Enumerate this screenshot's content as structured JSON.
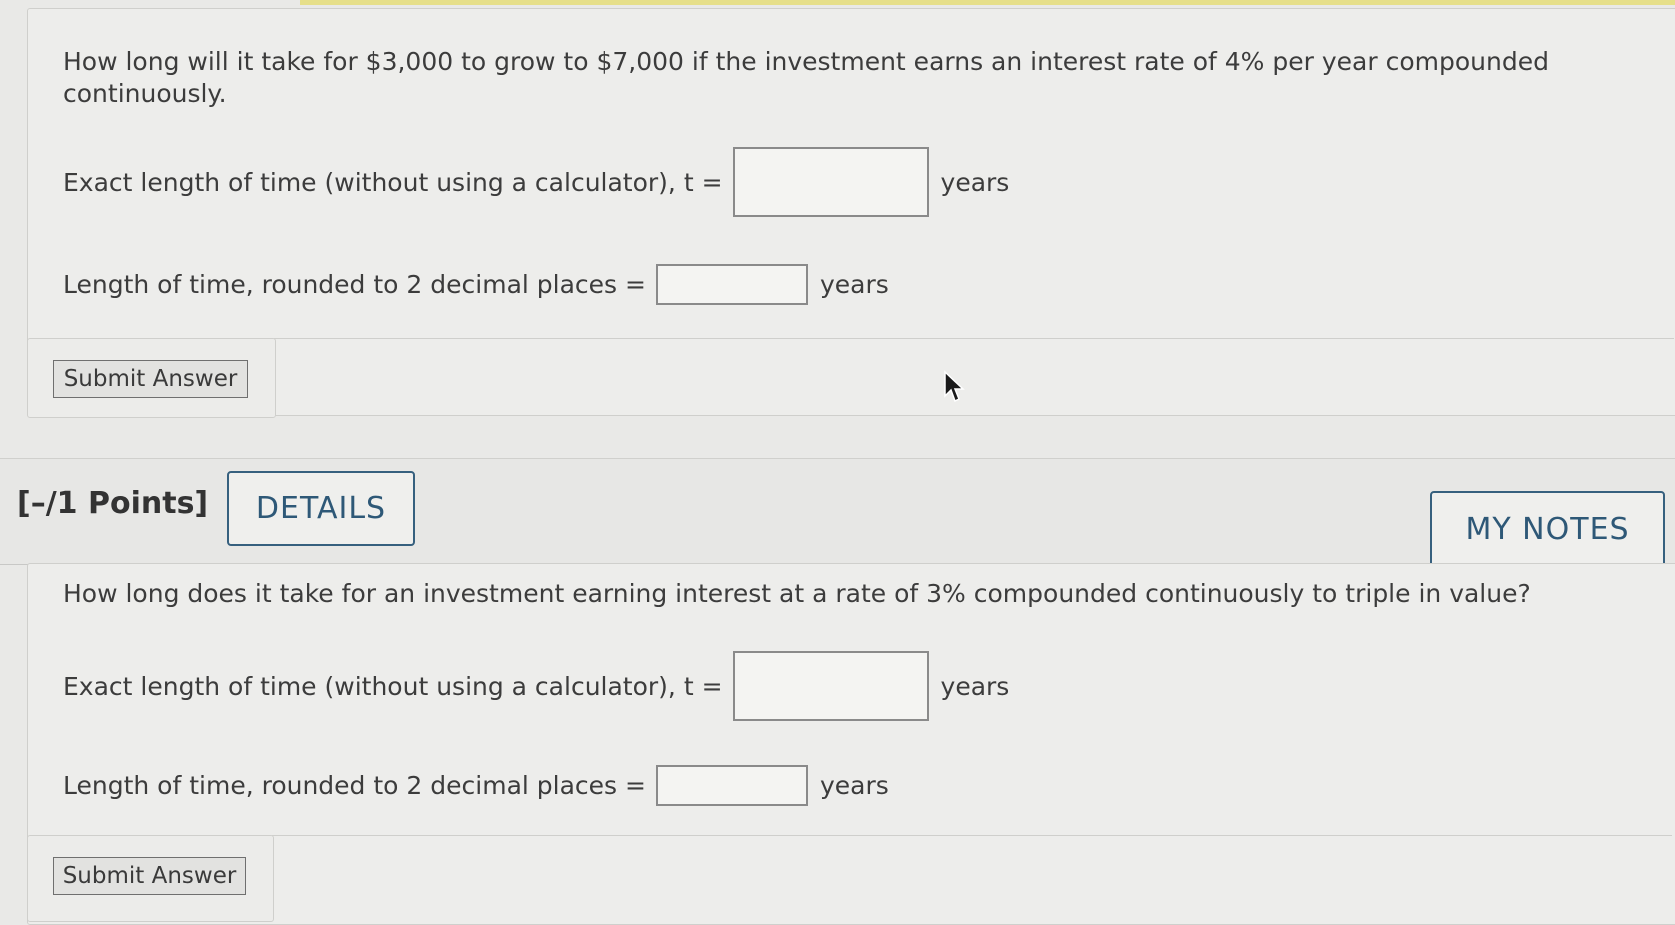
{
  "question1": {
    "text": "How long will it take for $3,000 to grow to $7,000 if the investment earns an interest rate of 4% per year compounded continuously.",
    "exact_label": "Exact length of time (without using a calculator), t =",
    "exact_value": "",
    "exact_unit": "years",
    "rounded_label": "Length of time, rounded to 2 decimal places =",
    "rounded_value": "",
    "rounded_unit": "years",
    "submit_label": "Submit Answer"
  },
  "question2": {
    "points_label": "[–/1 Points]",
    "details_label": "DETAILS",
    "notes_label": "MY NOTES",
    "text": "How long does it take for an investment earning interest at a rate of 3% compounded continuously to triple in value?",
    "exact_label": "Exact length of time (without using a calculator), t =",
    "exact_value": "",
    "exact_unit": "years",
    "rounded_label": "Length of time, rounded to 2 decimal places =",
    "rounded_value": "",
    "rounded_unit": "years",
    "submit_label": "Submit Answer"
  },
  "colors": {
    "accent": "#36607e",
    "background": "#e9e9e7"
  },
  "icons": {
    "cursor": "mouse-pointer-icon"
  }
}
